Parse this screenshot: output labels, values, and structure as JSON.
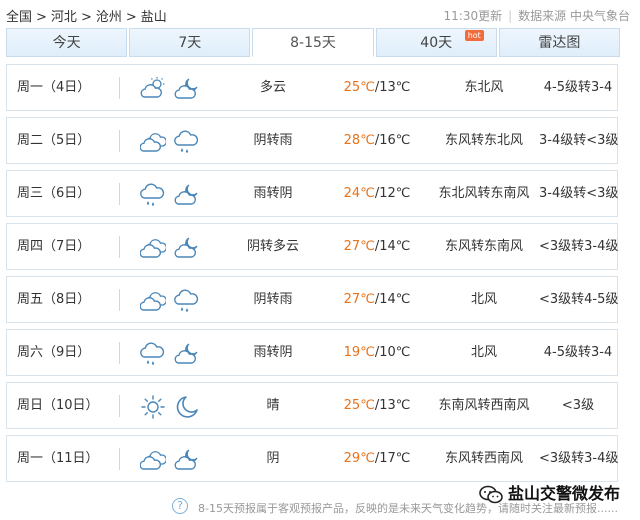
{
  "breadcrumb": {
    "items": [
      "全国",
      "河北",
      "沧州",
      "盐山"
    ],
    "separator": ">"
  },
  "source": {
    "update_time": "11:30更新",
    "data_source": "数据来源 中央气象台"
  },
  "tabs": [
    {
      "label": "今天",
      "active": false
    },
    {
      "label": "7天",
      "active": false
    },
    {
      "label": "8-15天",
      "active": true
    },
    {
      "label": "40天",
      "active": false,
      "badge": "hot"
    },
    {
      "label": "雷达图",
      "active": false
    }
  ],
  "forecast": [
    {
      "day": "周一（4日）",
      "icons": [
        "partly-cloudy-day-icon",
        "partly-cloudy-night-icon"
      ],
      "desc": "多云",
      "high": "25℃",
      "low": "/13℃",
      "wind": "东北风",
      "level": "4-5级转3-4"
    },
    {
      "day": "周二（5日）",
      "icons": [
        "overcast-icon",
        "rain-icon"
      ],
      "desc": "阴转雨",
      "high": "28℃",
      "low": "/16℃",
      "wind": "东风转东北风",
      "level": "3-4级转<3级"
    },
    {
      "day": "周三（6日）",
      "icons": [
        "rain-icon",
        "partly-cloudy-night-icon"
      ],
      "desc": "雨转阴",
      "high": "24℃",
      "low": "/12℃",
      "wind": "东北风转东南风",
      "level": "3-4级转<3级"
    },
    {
      "day": "周四（7日）",
      "icons": [
        "overcast-icon",
        "partly-cloudy-night-icon"
      ],
      "desc": "阴转多云",
      "high": "27℃",
      "low": "/14℃",
      "wind": "东风转东南风",
      "level": "<3级转3-4级"
    },
    {
      "day": "周五（8日）",
      "icons": [
        "overcast-icon",
        "rain-icon"
      ],
      "desc": "阴转雨",
      "high": "27℃",
      "low": "/14℃",
      "wind": "北风",
      "level": "<3级转4-5级"
    },
    {
      "day": "周六（9日）",
      "icons": [
        "rain-icon",
        "partly-cloudy-night-icon"
      ],
      "desc": "雨转阴",
      "high": "19℃",
      "low": "/10℃",
      "wind": "北风",
      "level": "4-5级转3-4"
    },
    {
      "day": "周日（10日）",
      "icons": [
        "sunny-icon",
        "moon-icon"
      ],
      "desc": "晴",
      "high": "25℃",
      "low": "/13℃",
      "wind": "东南风转西南风",
      "level": "<3级"
    },
    {
      "day": "周一（11日）",
      "icons": [
        "overcast-icon",
        "partly-cloudy-night-icon"
      ],
      "desc": "阴",
      "high": "29℃",
      "low": "/17℃",
      "wind": "东风转西南风",
      "level": "<3级转3-4级"
    }
  ],
  "footer": {
    "note": "8-15天预报属于客观预报产品，反映的是未来天气变化趋势，请随时关注最新预报......"
  },
  "watermark": {
    "text": "盐山交警微发布"
  },
  "colors": {
    "high_temp": "#e9731a",
    "icon_stroke": "#4a86b8",
    "tab_active_bg": "#ffffff",
    "tab_bg": "#e4f0fb"
  }
}
